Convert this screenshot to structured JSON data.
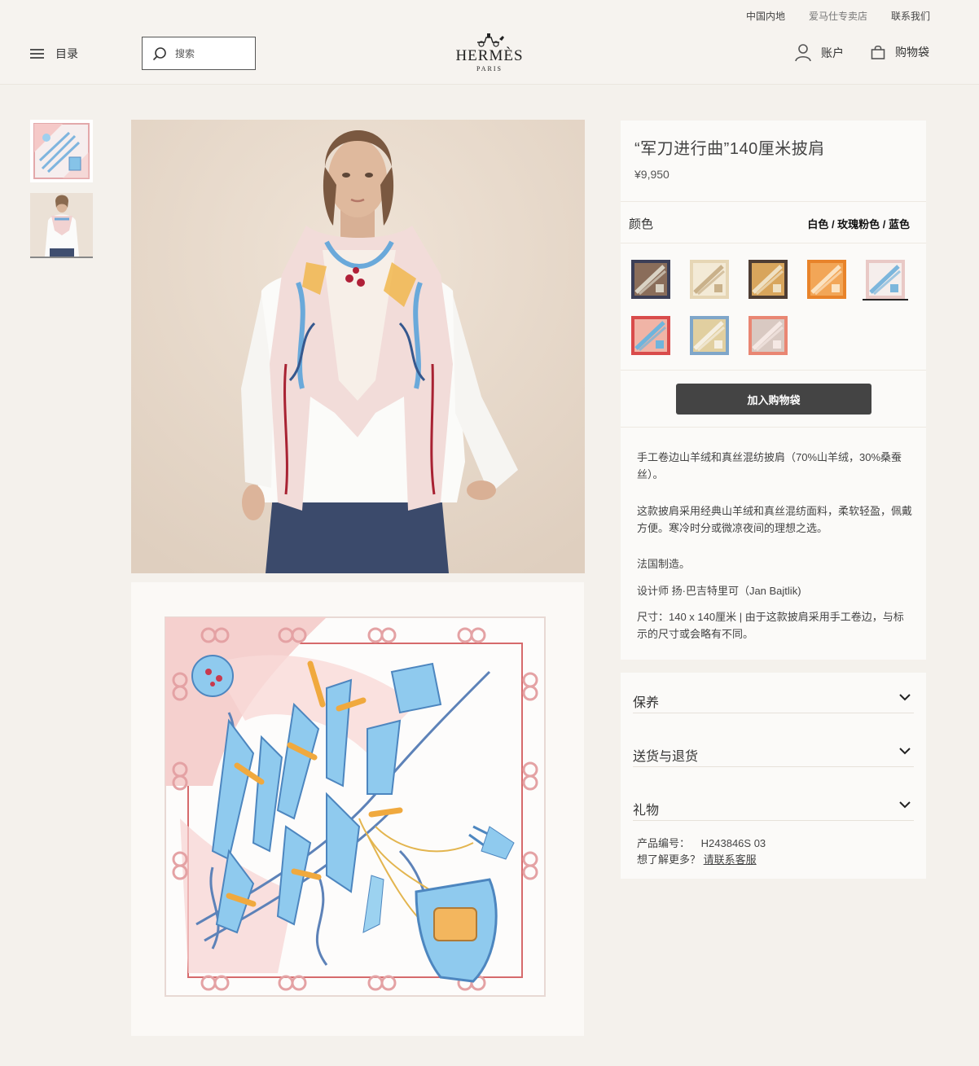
{
  "header": {
    "util_links": [
      "中国内地",
      "爱马仕专卖店",
      "联系我们"
    ],
    "menu_label": "目录",
    "search_placeholder": "搜索",
    "logo_text": "HERMÈS",
    "logo_sub": "PARIS",
    "account_label": "账户",
    "bag_label": "购物袋"
  },
  "product": {
    "title": "“军刀进行曲”140厘米披肩",
    "price": "¥9,950",
    "color_label": "颜色",
    "color_value": "白色 / 玫瑰粉色 / 蓝色",
    "add_to_bag": "加入购物袋",
    "description": [
      "手工卷边山羊绒和真丝混纺披肩（70%山羊绒，30%桑蚕丝）。",
      "这款披肩采用经典山羊绒和真丝混纺面料，柔软轻盈，佩戴方便。寒冷时分或微凉夜间的理想之选。",
      "法国制造。",
      "设计师 扬·巴吉特里可（Jan Bajtlik)",
      "尺寸：140 x 140厘米 | 由于这款披肩采用手工卷边，与标示的尺寸或会略有不同。"
    ],
    "swatches": [
      {
        "name": "navy-brown",
        "frame": "#3c3f57",
        "fill": "#8a6d5a",
        "accent": "#d9d2c4"
      },
      {
        "name": "beige-cream",
        "frame": "#e6d6b5",
        "fill": "#f3ead6",
        "accent": "#c9b18a"
      },
      {
        "name": "brown-gold",
        "frame": "#4e3d33",
        "fill": "#d8a55c",
        "accent": "#efe1c4"
      },
      {
        "name": "orange",
        "frame": "#e8832a",
        "fill": "#f2a657",
        "accent": "#fbe3c2"
      },
      {
        "name": "white-pink-blue",
        "frame": "#e9c9c6",
        "fill": "#f5eeec",
        "accent": "#7cb6dc"
      },
      {
        "name": "red-blue",
        "frame": "#d94b4b",
        "fill": "#f0b4a6",
        "accent": "#6fb4dc"
      },
      {
        "name": "blue-gold",
        "frame": "#7fa6c9",
        "fill": "#e1cfa0",
        "accent": "#f5efe2"
      },
      {
        "name": "coral-grey",
        "frame": "#e98673",
        "fill": "#d9c9c2",
        "accent": "#f5e8e4"
      }
    ]
  },
  "accordion": [
    "保养",
    "送货与退货",
    "礼物"
  ],
  "meta": {
    "sku_label": "产品编号：",
    "sku": "H243846S 03",
    "more_label": "想了解更多？",
    "contact_link": "请联系客服"
  },
  "colors": {
    "accent_button": "#444444",
    "page_bg": "#f4f1ec"
  }
}
